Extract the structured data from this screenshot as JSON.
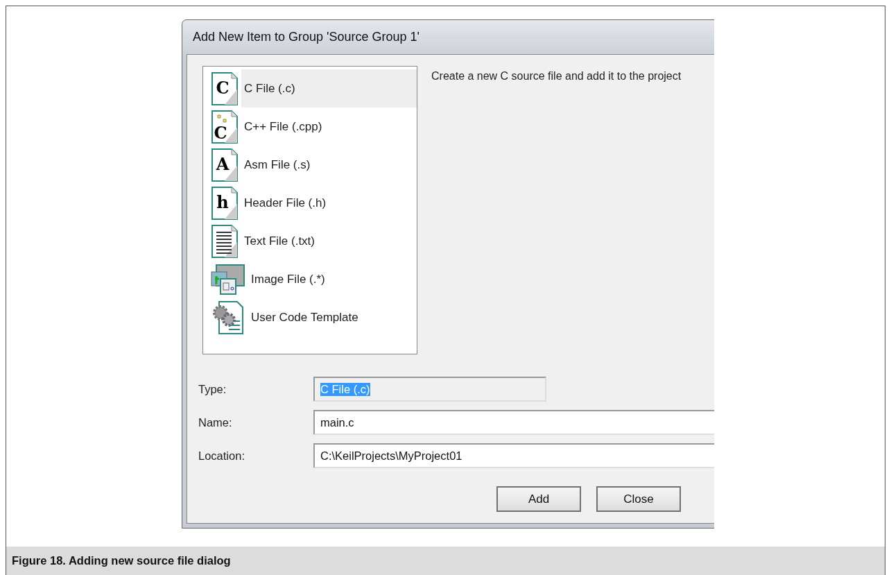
{
  "dialog": {
    "title": "Add New Item to Group 'Source Group 1'",
    "items": [
      {
        "label": "C File (.c)",
        "kind": "c",
        "icon_glyph": "C",
        "selected": true
      },
      {
        "label": "C++ File (.cpp)",
        "kind": "cpp",
        "icon_glyph": "C",
        "selected": false
      },
      {
        "label": "Asm File (.s)",
        "kind": "asm",
        "icon_glyph": "A",
        "selected": false
      },
      {
        "label": "Header File (.h)",
        "kind": "header",
        "icon_glyph": "h",
        "selected": false
      },
      {
        "label": "Text File (.txt)",
        "kind": "text",
        "selected": false
      },
      {
        "label": "Image File (.*)",
        "kind": "image",
        "selected": false
      },
      {
        "label": "User Code Template",
        "kind": "template",
        "selected": false
      }
    ],
    "description": "Create a new C source file and add it to the project",
    "fields": [
      {
        "label": "Type:",
        "value": "C File (.c)",
        "disabled": true,
        "highlighted": true
      },
      {
        "label": "Name:",
        "value": "main.c",
        "disabled": false,
        "highlighted": false
      },
      {
        "label": "Location:",
        "value": "C:\\KeilProjects\\MyProject01",
        "disabled": false,
        "highlighted": false
      }
    ],
    "buttons": [
      "Add",
      "Close"
    ]
  },
  "caption": "Figure 18.  Adding new source file dialog"
}
